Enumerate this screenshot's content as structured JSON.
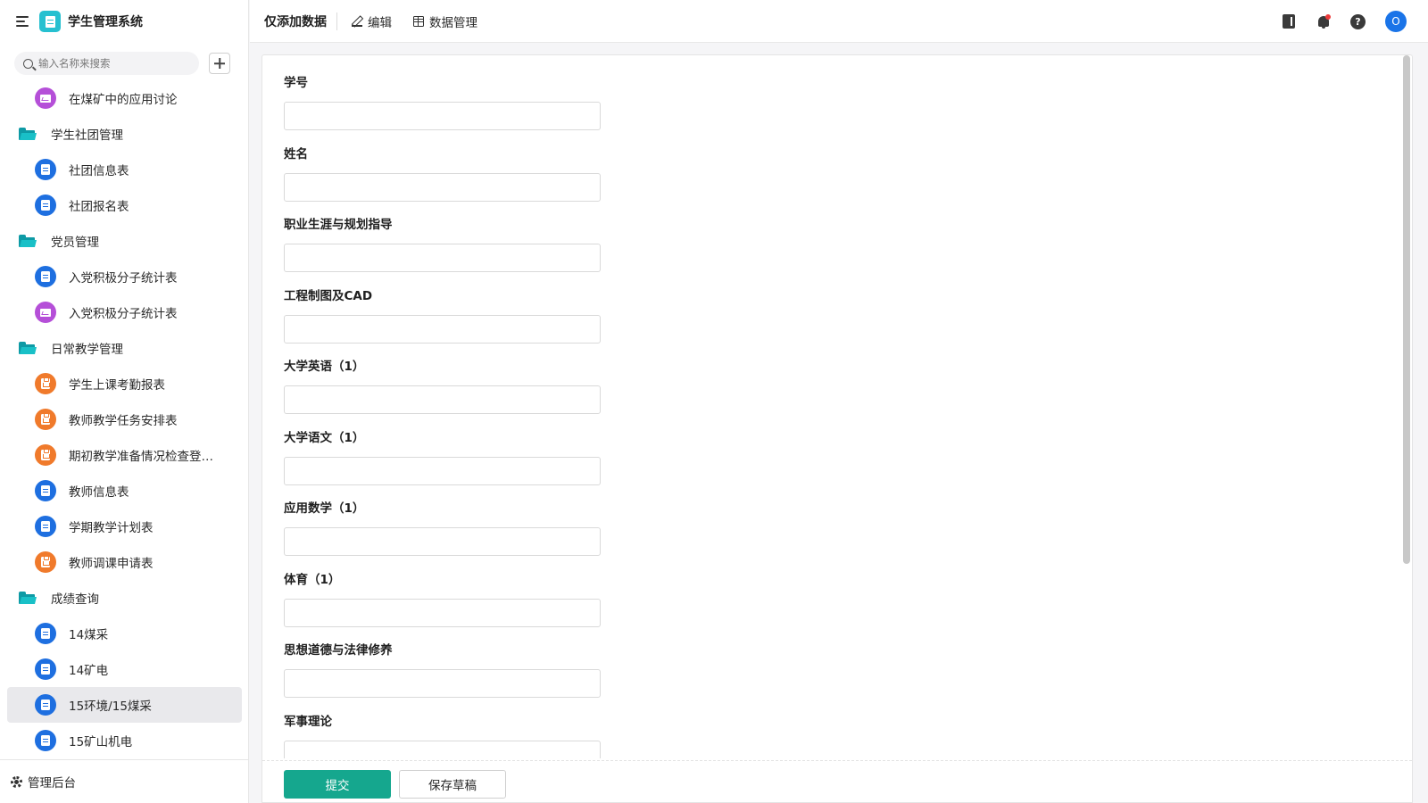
{
  "app": {
    "title": "学生管理系统"
  },
  "sidebar": {
    "search": {
      "placeholder": "输入名称来搜索"
    },
    "items": [
      {
        "type": "child",
        "icon": "chart-icon",
        "color": "purple",
        "label": "在煤矿中的应用讨论"
      },
      {
        "type": "folder",
        "icon": "folder-icon",
        "label": "学生社团管理"
      },
      {
        "type": "child",
        "icon": "form-icon",
        "color": "blue",
        "label": "社团信息表"
      },
      {
        "type": "child",
        "icon": "form-icon",
        "color": "blue",
        "label": "社团报名表"
      },
      {
        "type": "folder",
        "icon": "folder-icon",
        "label": "党员管理"
      },
      {
        "type": "child",
        "icon": "form-icon",
        "color": "blue",
        "label": "入党积极分子统计表"
      },
      {
        "type": "child",
        "icon": "chart-icon",
        "color": "purple",
        "label": "入党积极分子统计表"
      },
      {
        "type": "folder",
        "icon": "folder-icon",
        "label": "日常教学管理"
      },
      {
        "type": "child",
        "icon": "flow-icon",
        "color": "orange",
        "label": "学生上课考勤报表"
      },
      {
        "type": "child",
        "icon": "flow-icon",
        "color": "orange",
        "label": "教师教学任务安排表"
      },
      {
        "type": "child",
        "icon": "flow-icon",
        "color": "orange",
        "label": "期初教学准备情况检查登记表"
      },
      {
        "type": "child",
        "icon": "form-icon",
        "color": "blue",
        "label": "教师信息表"
      },
      {
        "type": "child",
        "icon": "form-icon",
        "color": "blue",
        "label": "学期教学计划表"
      },
      {
        "type": "child",
        "icon": "flow-icon",
        "color": "orange",
        "label": "教师调课申请表"
      },
      {
        "type": "folder",
        "icon": "folder-icon",
        "label": "成绩查询"
      },
      {
        "type": "child",
        "icon": "form-icon",
        "color": "blue",
        "label": "14煤采"
      },
      {
        "type": "child",
        "icon": "form-icon",
        "color": "blue",
        "label": "14矿电"
      },
      {
        "type": "child",
        "icon": "form-icon",
        "color": "blue",
        "label": "15环境/15煤采",
        "active": true
      },
      {
        "type": "child",
        "icon": "form-icon",
        "color": "blue",
        "label": "15矿山机电"
      }
    ],
    "footer": {
      "label": "管理后台"
    }
  },
  "toolbar": {
    "title": "仅添加数据",
    "edit_label": "编辑",
    "data_manage_label": "数据管理",
    "avatar_initial": "O"
  },
  "form": {
    "fields": [
      {
        "label": "学号",
        "value": ""
      },
      {
        "label": "姓名",
        "value": ""
      },
      {
        "label": "职业生涯与规划指导",
        "value": ""
      },
      {
        "label": "工程制图及CAD",
        "value": ""
      },
      {
        "label": "大学英语（1）",
        "value": ""
      },
      {
        "label": "大学语文（1）",
        "value": ""
      },
      {
        "label": "应用数学（1）",
        "value": ""
      },
      {
        "label": "体育（1）",
        "value": ""
      },
      {
        "label": "思想道德与法律修养",
        "value": ""
      },
      {
        "label": "军事理论",
        "value": ""
      }
    ],
    "submit_label": "提交",
    "draft_label": "保存草稿"
  },
  "colors": {
    "accent": "#15a78e",
    "folder": "#19c0c7",
    "blue": "#1e6fe0",
    "purple": "#b54fd8",
    "orange": "#f07a2b",
    "avatar": "#1a74e8"
  }
}
